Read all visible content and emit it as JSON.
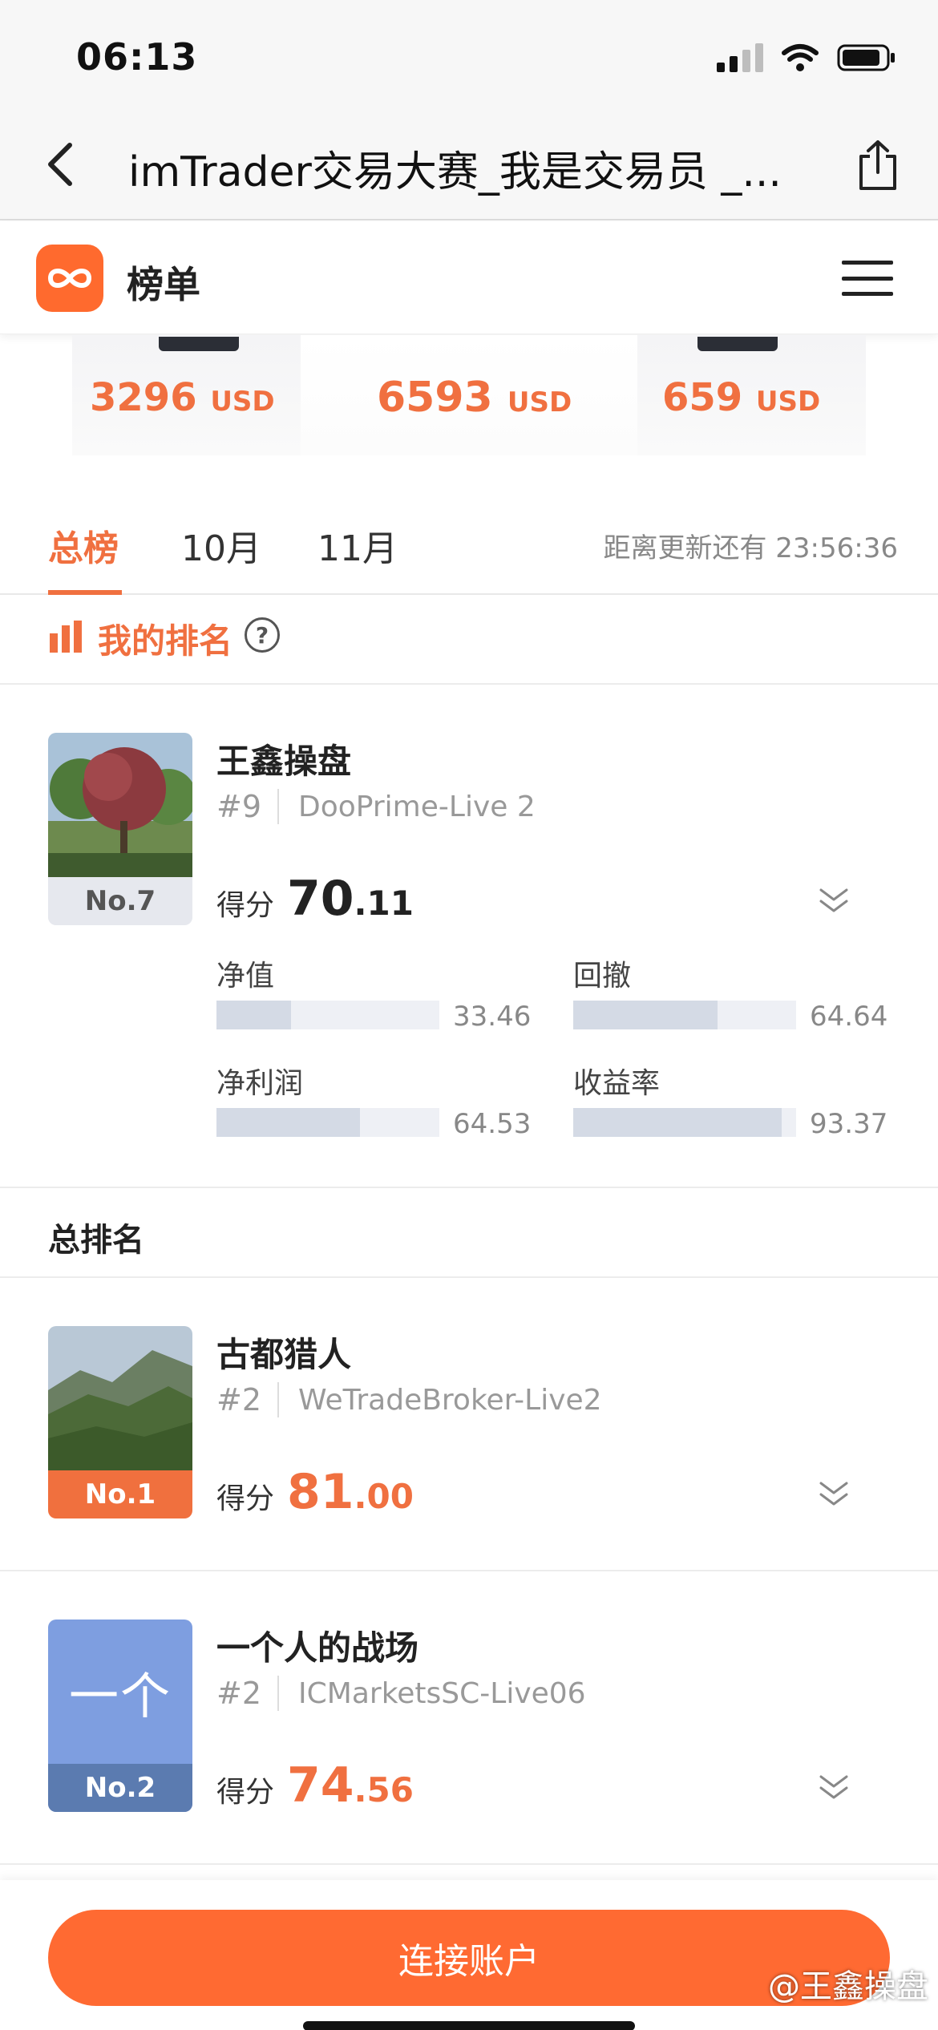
{
  "status_bar": {
    "time": "06:13"
  },
  "nav": {
    "title": "imTrader交易大赛_我是交易员 _..."
  },
  "app_header": {
    "title": "榜单"
  },
  "prizes": [
    {
      "amount": "3296",
      "unit": "USD"
    },
    {
      "amount": "6593",
      "unit": "USD"
    },
    {
      "amount": "659",
      "unit": "USD"
    }
  ],
  "tabs": [
    {
      "label": "总榜",
      "active": true
    },
    {
      "label": "10月",
      "active": false
    },
    {
      "label": "11月",
      "active": false
    }
  ],
  "countdown": "距离更新还有 23:56:36",
  "my_rank": {
    "heading": "我的排名",
    "help": "?",
    "card": {
      "badge": "No.7",
      "name": "王鑫操盘",
      "rank": "#9",
      "server": "DooPrime-Live 2",
      "score_label": "得分",
      "score_int": "70",
      "score_dec": ".11",
      "metrics": [
        {
          "label": "净值",
          "value": "33.46",
          "fraction": 0.3346
        },
        {
          "label": "回撤",
          "value": "64.64",
          "fraction": 0.6464
        },
        {
          "label": "净利润",
          "value": "64.53",
          "fraction": 0.6453
        },
        {
          "label": "收益率",
          "value": "93.37",
          "fraction": 0.9337
        }
      ]
    }
  },
  "overall": {
    "heading": "总排名",
    "entries": [
      {
        "badge": "No.1",
        "name": "古都猎人",
        "rank": "#2",
        "server": "WeTradeBroker-Live2",
        "score_label": "得分",
        "score_int": "81",
        "score_dec": ".00"
      },
      {
        "badge": "No.2",
        "avatar_text": "一个",
        "name": "一个人的战场",
        "rank": "#2",
        "server": "ICMarketsSC-Live06",
        "score_label": "得分",
        "score_int": "74",
        "score_dec": ".56"
      }
    ]
  },
  "bottom": {
    "connect_label": "连接账户",
    "watermark": "@王鑫操盘"
  },
  "colors": {
    "accent": "#f07040",
    "button": "#ff6a32",
    "badge_blue": "#5b7bb0"
  }
}
